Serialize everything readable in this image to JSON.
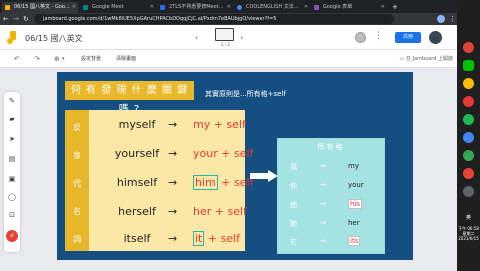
{
  "tabs": [
    {
      "label": "06/15 國八英文 - Goo...",
      "color": "#f4b400",
      "active": true
    },
    {
      "label": "Google Meet",
      "color": "#00897b",
      "active": false
    },
    {
      "label": "2TLS不熟悉要修Meet...",
      "color": "#1a73e8",
      "active": false
    },
    {
      "label": "COOLENGLISH 文法...",
      "color": "#4285f4",
      "active": false
    },
    {
      "label": "Google 表單",
      "color": "#7e57c2",
      "active": false
    }
  ],
  "address": {
    "url_host": "jamboard.google.com",
    "url_path": "/d/1wMk8iUEb0pGArz...",
    "full": "jamboard.google.com/d/1wMk8iUE5XpGAruCHPACbDOqqjCjC.al/Pxdm7eBAUbjgQ/viewer?f=5"
  },
  "jam": {
    "title": "06/15 國八英文",
    "frame_count": "2 / 2",
    "share_label": "共用",
    "toolbar": {
      "set_background": "設定背景",
      "clear_frame": "清除畫面",
      "open_in_app": "在 Jamboard 上開啟"
    }
  },
  "board": {
    "title": "何 有 發 現 什 麼 關 鍵 嗎 ?",
    "subtitle": "其實原則是...所有格+self",
    "side_chars": [
      "反",
      "身",
      "代",
      "名",
      "詞"
    ],
    "rows": [
      {
        "pronoun": "myself",
        "arrow": "→",
        "form": "my + self",
        "highlight": ""
      },
      {
        "pronoun": "yourself",
        "arrow": "→",
        "form": "your + self",
        "highlight": ""
      },
      {
        "pronoun": "himself",
        "arrow": "→",
        "form_highlight": "him",
        "form_rest": "+ self"
      },
      {
        "pronoun": "herself",
        "arrow": "→",
        "form": "her + self",
        "highlight": ""
      },
      {
        "pronoun": "itself",
        "arrow": "→",
        "form_highlight": "it",
        "form_rest": "+ self"
      }
    ],
    "possessive": {
      "header": "所有格",
      "rows": [
        {
          "cn": "我",
          "arrow": "→",
          "en": "my",
          "red": false,
          "box": false
        },
        {
          "cn": "你",
          "arrow": "→",
          "en": "your",
          "red": false,
          "box": false
        },
        {
          "cn": "他",
          "arrow": "→",
          "en": "his",
          "red": true,
          "box": true
        },
        {
          "cn": "她",
          "arrow": "→",
          "en": "her",
          "red": false,
          "box": false
        },
        {
          "cn": "它",
          "arrow": "→",
          "en": "its",
          "red": true,
          "box": true
        }
      ]
    }
  },
  "system": {
    "lang": "英",
    "time": "下午 06:58",
    "weekday": "星期二",
    "date": "2021/6/15"
  },
  "colors": {
    "board_bg": "#154f82",
    "title_yellow": "#e9b82b",
    "panel_cream": "#fbe8a6",
    "teal": "#a4e3e2",
    "red_text": "#e53935",
    "highlight_border": "#2bb5a8",
    "share_blue": "#1a73e8"
  }
}
